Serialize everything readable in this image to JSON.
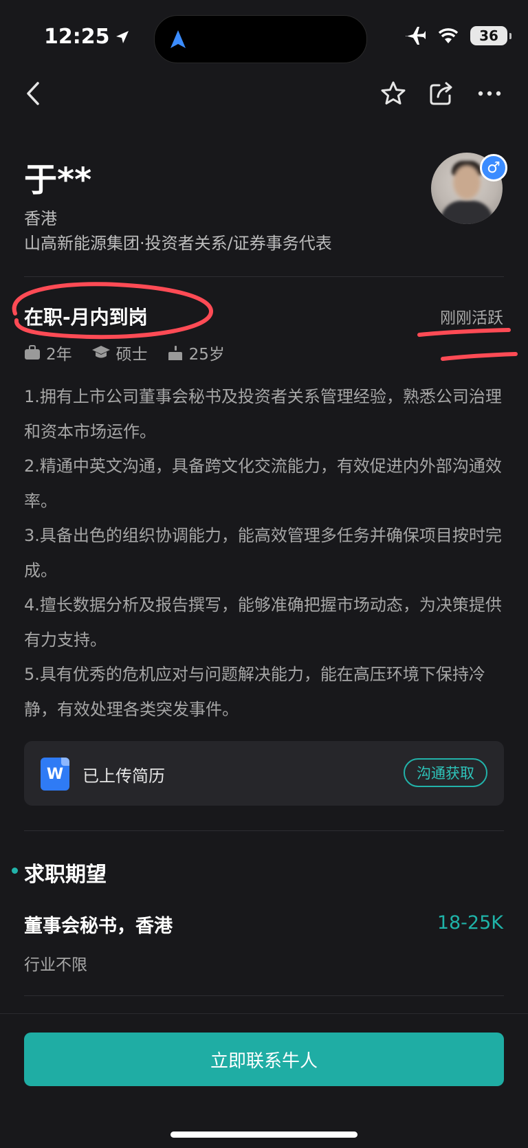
{
  "status_bar": {
    "time": "12:25",
    "battery": "36",
    "icons": [
      "location-arrow-icon",
      "airplane-icon",
      "wifi-icon",
      "battery-icon"
    ]
  },
  "nav": {
    "icons": [
      "back-icon",
      "star-icon",
      "share-icon",
      "more-icon"
    ]
  },
  "profile": {
    "name": "于**",
    "city": "香港",
    "company": "山高新能源集团·投资者关系/证券事务代表",
    "gender_symbol": "♂",
    "employment_status": "在职-月内到岗",
    "active_status": "刚刚活跃",
    "experience": "2年",
    "education": "硕士",
    "age": "25岁"
  },
  "summary": [
    "1.拥有上市公司董事会秘书及投资者关系管理经验，熟悉公司治理和资本市场运作。",
    "2.精通中英文沟通，具备跨文化交流能力，有效促进内外部沟通效率。",
    "3.具备出色的组织协调能力，能高效管理多任务并确保项目按时完成。",
    "4.擅长数据分析及报告撰写，能够准确把握市场动态，为决策提供有力支持。",
    "5.具有优秀的危机应对与问题解决能力，能在高压环境下保持冷静，有效处理各类突发事件。"
  ],
  "resume": {
    "icon_letter": "W",
    "label": "已上传简历",
    "button": "沟通获取"
  },
  "expectation": {
    "section_title": "求职期望",
    "job": "董事会秘书，香港",
    "salary": "18-25K",
    "industry": "行业不限"
  },
  "cta": {
    "label": "立即联系牛人"
  },
  "colors": {
    "background": "#18181b",
    "accent": "#1fada4",
    "annotation": "#ff4b55"
  }
}
